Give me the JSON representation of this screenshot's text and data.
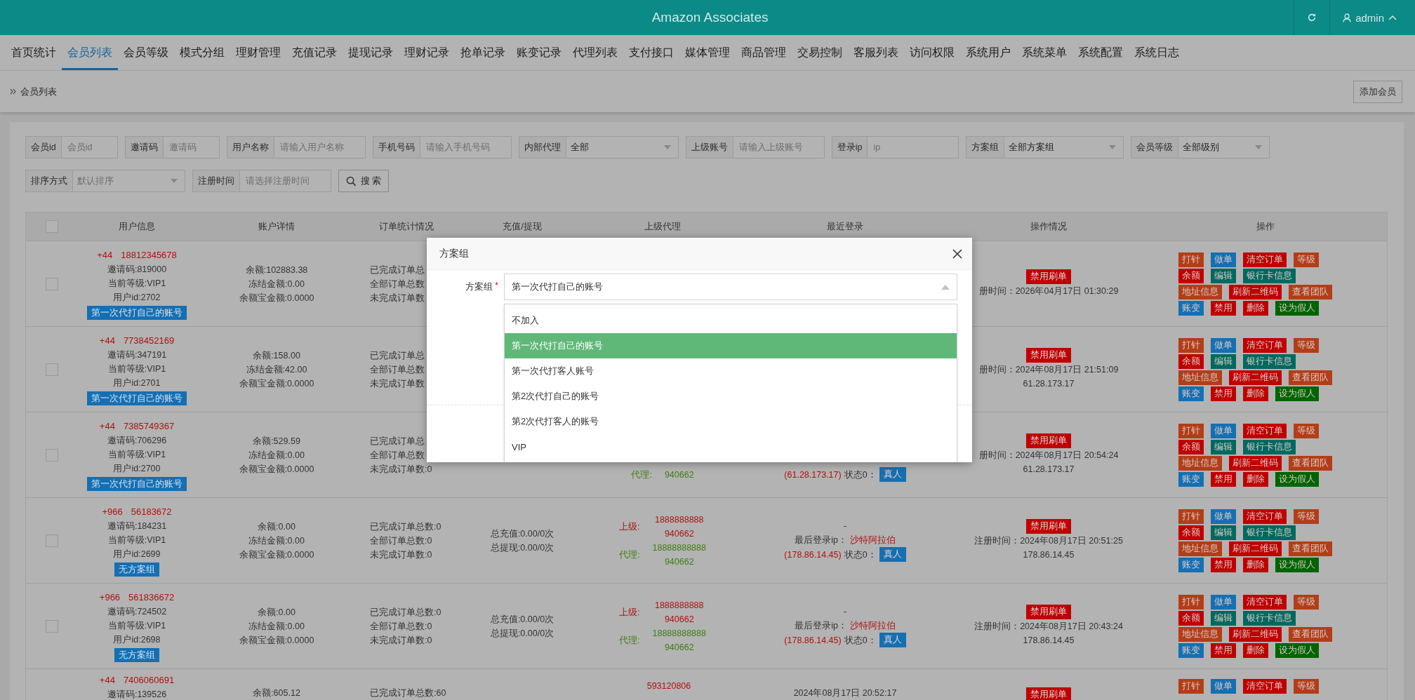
{
  "header": {
    "title": "Amazon Associates",
    "user": "admin"
  },
  "nav": [
    {
      "label": "首页统计",
      "selected": false
    },
    {
      "label": "会员列表",
      "selected": true
    },
    {
      "label": "会员等级",
      "selected": false
    },
    {
      "label": "模式分组",
      "selected": false
    },
    {
      "label": "理财管理",
      "selected": false
    },
    {
      "label": "充值记录",
      "selected": false
    },
    {
      "label": "提现记录",
      "selected": false
    },
    {
      "label": "理财记录",
      "selected": false
    },
    {
      "label": "抢单记录",
      "selected": false
    },
    {
      "label": "账变记录",
      "selected": false
    },
    {
      "label": "代理列表",
      "selected": false
    },
    {
      "label": "支付接口",
      "selected": false
    },
    {
      "label": "媒体管理",
      "selected": false
    },
    {
      "label": "商品管理",
      "selected": false
    },
    {
      "label": "交易控制",
      "selected": false
    },
    {
      "label": "客服列表",
      "selected": false
    },
    {
      "label": "访问权限",
      "selected": false
    },
    {
      "label": "系统用户",
      "selected": false
    },
    {
      "label": "系统菜单",
      "selected": false
    },
    {
      "label": "系统配置",
      "selected": false
    },
    {
      "label": "系统日志",
      "selected": false
    }
  ],
  "breadcrumb": {
    "current": "会员列表",
    "button": "添加会员"
  },
  "filters": [
    {
      "kind": "input",
      "label": "会员id",
      "placeholder": "会员id"
    },
    {
      "kind": "input",
      "label": "邀请码",
      "placeholder": "邀请码"
    },
    {
      "kind": "input",
      "label": "用户名称",
      "placeholder": "请输入用户名称"
    },
    {
      "kind": "input",
      "label": "手机号码",
      "placeholder": "请输入手机号码"
    },
    {
      "kind": "select",
      "label": "内部代理",
      "value": "全部"
    },
    {
      "kind": "input",
      "label": "上级账号",
      "placeholder": "请输入上级账号"
    },
    {
      "kind": "input",
      "label": "登录ip",
      "placeholder": "ip"
    },
    {
      "kind": "select",
      "label": "方案组",
      "value": "全部方案组"
    },
    {
      "kind": "select",
      "label": "会员等级",
      "value": "全部级别"
    },
    {
      "kind": "select",
      "label": "排序方式",
      "placeholder": "默认排序"
    },
    {
      "kind": "input",
      "label": "注册时间",
      "placeholder": "请选择注册时间"
    },
    {
      "kind": "button",
      "label": "搜 索"
    }
  ],
  "table": {
    "columns": [
      "用户信息",
      "账户详情",
      "订单统计情况",
      "充值/提现",
      "上级代理",
      "最近登录",
      "操作情况",
      "操作"
    ],
    "select_all": {
      "checked": false
    },
    "rows": [
      {
        "checked": false,
        "country_code": "+44",
        "phone": "18812345678",
        "info": [
          "邀请码:819000",
          "当前等级:VIP1",
          "用户id:2702"
        ],
        "tag": "第一次代打自己的账号",
        "account": [
          "余额:102883.38",
          "冻结金额:0.00",
          "余额宝金额:0.0000"
        ],
        "orders": [
          "已完成订单总",
          "全部订单总数",
          "未完成订单数"
        ],
        "status": {
          "badge": "禁用刷单",
          "registered": "册时间：2026年04月17日 01:30:29"
        },
        "actions": [
          [
            {
              "label": "打针",
              "color": "#b33d18"
            },
            {
              "label": "做单",
              "color": "#156fb3"
            },
            {
              "label": "清空订单",
              "color": "#c00000"
            },
            {
              "label": "等级",
              "color": "#b33d18"
            }
          ],
          [
            {
              "label": "余额",
              "color": "#c00000"
            },
            {
              "label": "编辑",
              "color": "#00695f"
            },
            {
              "label": "银行卡信息",
              "color": "#00695f"
            }
          ],
          [
            {
              "label": "地址信息",
              "color": "#b33d18"
            },
            {
              "label": "刷新二维码",
              "color": "#c00000"
            },
            {
              "label": "查看团队",
              "color": "#b33d18"
            }
          ],
          [
            {
              "label": "账变",
              "color": "#156fb3"
            },
            {
              "label": "禁用",
              "color": "#c00000"
            },
            {
              "label": "删除",
              "color": "#c00000"
            },
            {
              "label": "设为假人",
              "color": "#006400"
            }
          ]
        ]
      },
      {
        "checked": false,
        "country_code": "+44",
        "phone": "7738452169",
        "info": [
          "邀请码:347191",
          "当前等级:VIP1",
          "用户id:2701"
        ],
        "tag": "第一次代打自己的账号",
        "account": [
          "余额:158.00",
          "冻结金额:42.00",
          "余额宝金额:0.0000"
        ],
        "orders": [
          "已完成订单总",
          "全部订单总数",
          "未完成订单数"
        ],
        "status": {
          "badge": "禁用刷单",
          "registered": "册时间：2024年08月17日 21:51:09",
          "ip": "61.28.173.17"
        },
        "actions": [
          [
            {
              "label": "打针",
              "color": "#b33d18"
            },
            {
              "label": "做单",
              "color": "#156fb3"
            },
            {
              "label": "清空订单",
              "color": "#c00000"
            },
            {
              "label": "等级",
              "color": "#b33d18"
            }
          ],
          [
            {
              "label": "余额",
              "color": "#c00000"
            },
            {
              "label": "编辑",
              "color": "#00695f"
            },
            {
              "label": "银行卡信息",
              "color": "#00695f"
            }
          ],
          [
            {
              "label": "地址信息",
              "color": "#b33d18"
            },
            {
              "label": "刷新二维码",
              "color": "#c00000"
            },
            {
              "label": "查看团队",
              "color": "#b33d18"
            }
          ],
          [
            {
              "label": "账变",
              "color": "#156fb3"
            },
            {
              "label": "禁用",
              "color": "#c00000"
            },
            {
              "label": "删除",
              "color": "#c00000"
            },
            {
              "label": "设为假人",
              "color": "#006400"
            }
          ]
        ]
      },
      {
        "checked": false,
        "country_code": "+44",
        "phone": "7385749367",
        "info": [
          "邀请码:706296",
          "当前等级:VIP1",
          "用户id:2700"
        ],
        "tag": "第一次代打自己的账号",
        "account": [
          "余额:529.59",
          "冻结金额:0.00",
          "余额宝金额:0.0000"
        ],
        "orders": [
          "已完成订单总",
          "全部订单总数",
          "未完成订单数:0"
        ],
        "agent": {
          "agent_label": "代理:",
          "agent": [
            "940662"
          ]
        },
        "login": {
          "ip": "(61.28.173.17)",
          "status": "状态0：",
          "badge": "真人"
        },
        "status": {
          "badge": "禁用刷单",
          "registered": "册时间：2024年08月17日 20:54:24",
          "ip": "61.28.173.17"
        },
        "actions": [
          [
            {
              "label": "打针",
              "color": "#b33d18"
            },
            {
              "label": "做单",
              "color": "#156fb3"
            },
            {
              "label": "清空订单",
              "color": "#c00000"
            },
            {
              "label": "等级",
              "color": "#b33d18"
            }
          ],
          [
            {
              "label": "余额",
              "color": "#c00000"
            },
            {
              "label": "编辑",
              "color": "#00695f"
            },
            {
              "label": "银行卡信息",
              "color": "#00695f"
            }
          ],
          [
            {
              "label": "地址信息",
              "color": "#b33d18"
            },
            {
              "label": "刷新二维码",
              "color": "#c00000"
            },
            {
              "label": "查看团队",
              "color": "#b33d18"
            }
          ],
          [
            {
              "label": "账变",
              "color": "#156fb3"
            },
            {
              "label": "禁用",
              "color": "#c00000"
            },
            {
              "label": "删除",
              "color": "#c00000"
            },
            {
              "label": "设为假人",
              "color": "#006400"
            }
          ]
        ]
      },
      {
        "checked": false,
        "country_code": "+966",
        "phone": "56183672",
        "info": [
          "邀请码:184231",
          "当前等级:VIP1",
          "用户id:2699"
        ],
        "tag": "无方案组",
        "account": [
          "余额:0.00",
          "冻结金额:0.00",
          "余额宝金额:0.0000"
        ],
        "orders": [
          "已完成订单总数:0",
          "全部订单总数:0",
          "未完成订单数:0"
        ],
        "recharge": [
          "总充值:0.00/0次",
          "总提现:0.00/0次"
        ],
        "agent": {
          "superior_label": "上级:",
          "superior": [
            "1888888888",
            "940662"
          ],
          "agent_label": "代理:",
          "agent": [
            "18888888888",
            "940662"
          ]
        },
        "login": {
          "dash": "-",
          "ip_label": "最后登录ip：",
          "location": "沙特阿拉伯",
          "ip": "(178.86.14.45)",
          "status": "状态0：",
          "badge": "真人"
        },
        "status": {
          "badge": "禁用刷单",
          "registered": "注册时间：2024年08月17日 20:51:25",
          "ip": "178.86.14.45"
        },
        "actions": [
          [
            {
              "label": "打针",
              "color": "#b33d18"
            },
            {
              "label": "做单",
              "color": "#156fb3"
            },
            {
              "label": "清空订单",
              "color": "#c00000"
            },
            {
              "label": "等级",
              "color": "#b33d18"
            }
          ],
          [
            {
              "label": "余额",
              "color": "#c00000"
            },
            {
              "label": "编辑",
              "color": "#00695f"
            },
            {
              "label": "银行卡信息",
              "color": "#00695f"
            }
          ],
          [
            {
              "label": "地址信息",
              "color": "#b33d18"
            },
            {
              "label": "刷新二维码",
              "color": "#c00000"
            },
            {
              "label": "查看团队",
              "color": "#b33d18"
            }
          ],
          [
            {
              "label": "账变",
              "color": "#156fb3"
            },
            {
              "label": "禁用",
              "color": "#c00000"
            },
            {
              "label": "删除",
              "color": "#c00000"
            },
            {
              "label": "设为假人",
              "color": "#006400"
            }
          ]
        ]
      },
      {
        "checked": false,
        "country_code": "+966",
        "phone": "561836672",
        "info": [
          "邀请码:724502",
          "当前等级:VIP1",
          "用户id:2698"
        ],
        "tag": "无方案组",
        "account": [
          "余额:0.00",
          "冻结金额:0.00",
          "余额宝金额:0.0000"
        ],
        "orders": [
          "已完成订单总数:0",
          "全部订单总数:0",
          "未完成订单数:0"
        ],
        "recharge": [
          "总充值:0.00/0次",
          "总提现:0.00/0次"
        ],
        "agent": {
          "superior_label": "上级:",
          "superior": [
            "1888888888",
            "940662"
          ],
          "agent_label": "代理:",
          "agent": [
            "18888888888",
            "940662"
          ]
        },
        "login": {
          "dash": "-",
          "ip_label": "最后登录ip：",
          "location": "沙特阿拉伯",
          "ip": "(178.86.14.45)",
          "status": "状态0：",
          "badge": "真人"
        },
        "status": {
          "badge": "禁用刷单",
          "registered": "注册时间：2024年08月17日 20:43:24",
          "ip": "178.86.14.45"
        },
        "actions": [
          [
            {
              "label": "打针",
              "color": "#b33d18"
            },
            {
              "label": "做单",
              "color": "#156fb3"
            },
            {
              "label": "清空订单",
              "color": "#c00000"
            },
            {
              "label": "等级",
              "color": "#b33d18"
            }
          ],
          [
            {
              "label": "余额",
              "color": "#c00000"
            },
            {
              "label": "编辑",
              "color": "#00695f"
            },
            {
              "label": "银行卡信息",
              "color": "#00695f"
            }
          ],
          [
            {
              "label": "地址信息",
              "color": "#b33d18"
            },
            {
              "label": "刷新二维码",
              "color": "#c00000"
            },
            {
              "label": "查看团队",
              "color": "#b33d18"
            }
          ],
          [
            {
              "label": "账变",
              "color": "#156fb3"
            },
            {
              "label": "禁用",
              "color": "#c00000"
            },
            {
              "label": "删除",
              "color": "#c00000"
            },
            {
              "label": "设为假人",
              "color": "#006400"
            }
          ]
        ]
      },
      {
        "country_code": "+44",
        "phone": "7406060691",
        "info": [
          "邀请码:139526"
        ],
        "account": [
          "余额:605.12"
        ],
        "orders": [
          "已完成订单总数:60"
        ],
        "agent": {
          "superior": [
            "593120806"
          ]
        },
        "login": {
          "time": "2024年08月17日 20:52:17"
        },
        "status": {
          "badge": "禁用刷单"
        },
        "actions": [
          [
            {
              "label": "打针",
              "color": "#b33d18"
            },
            {
              "label": "做单",
              "color": "#156fb3"
            },
            {
              "label": "清空订单",
              "color": "#c00000"
            },
            {
              "label": "等级",
              "color": "#b33d18"
            }
          ]
        ]
      }
    ]
  },
  "modal": {
    "title": "方案组",
    "field_label": "方案组",
    "required_mark": "*",
    "value": "第一次代打自己的账号",
    "expanded": true,
    "options": [
      {
        "label": "不加入",
        "selected": false
      },
      {
        "label": "第一次代打自己的账号",
        "selected": true
      },
      {
        "label": "第一次代打客人账号",
        "selected": false
      },
      {
        "label": "第2次代打自己的账号",
        "selected": false
      },
      {
        "label": "第2次代打客人的账号",
        "selected": false
      },
      {
        "label": "VIP",
        "selected": false
      }
    ]
  }
}
